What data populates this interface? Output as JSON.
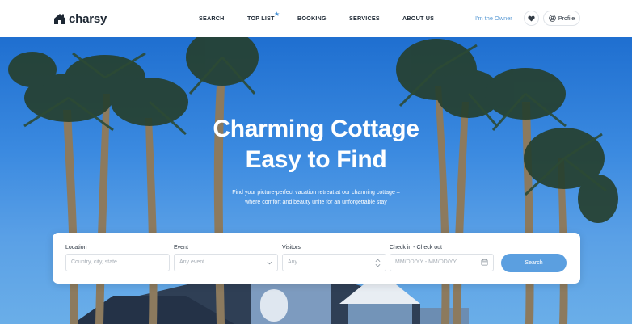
{
  "brand": {
    "name": "charsy"
  },
  "nav": {
    "items": [
      "SEARCH",
      "TOP LIST",
      "BOOKING",
      "SERVICES",
      "ABOUT US"
    ],
    "top_list_marker": "★"
  },
  "header_actions": {
    "owner_link": "I'm the Owner",
    "profile_label": "Profile",
    "favorites_icon": "heart-icon",
    "profile_icon": "user-circle-icon"
  },
  "hero": {
    "title_line1": "Charming Cottage",
    "title_line2": "Easy to Find",
    "subtitle_line1": "Find your picture-perfect vacation retreat at our charming cottage –",
    "subtitle_line2": "where comfort and beauty unite for an unforgettable stay"
  },
  "search": {
    "location": {
      "label": "Location",
      "placeholder": "Country, city, state"
    },
    "event": {
      "label": "Event",
      "placeholder": "Any event",
      "icon": "chevron-down-icon"
    },
    "visitors": {
      "label": "Visitors",
      "placeholder": "Any",
      "icon": "stepper-icon"
    },
    "dates": {
      "label": "Check in - Check out",
      "placeholder": "MM/DD/YY - MM/DD/YY",
      "icon": "calendar-icon"
    },
    "button_label": "Search"
  },
  "colors": {
    "accent": "#5b9fe0",
    "link": "#5b9bd5",
    "sky": "#3b8ae0"
  }
}
